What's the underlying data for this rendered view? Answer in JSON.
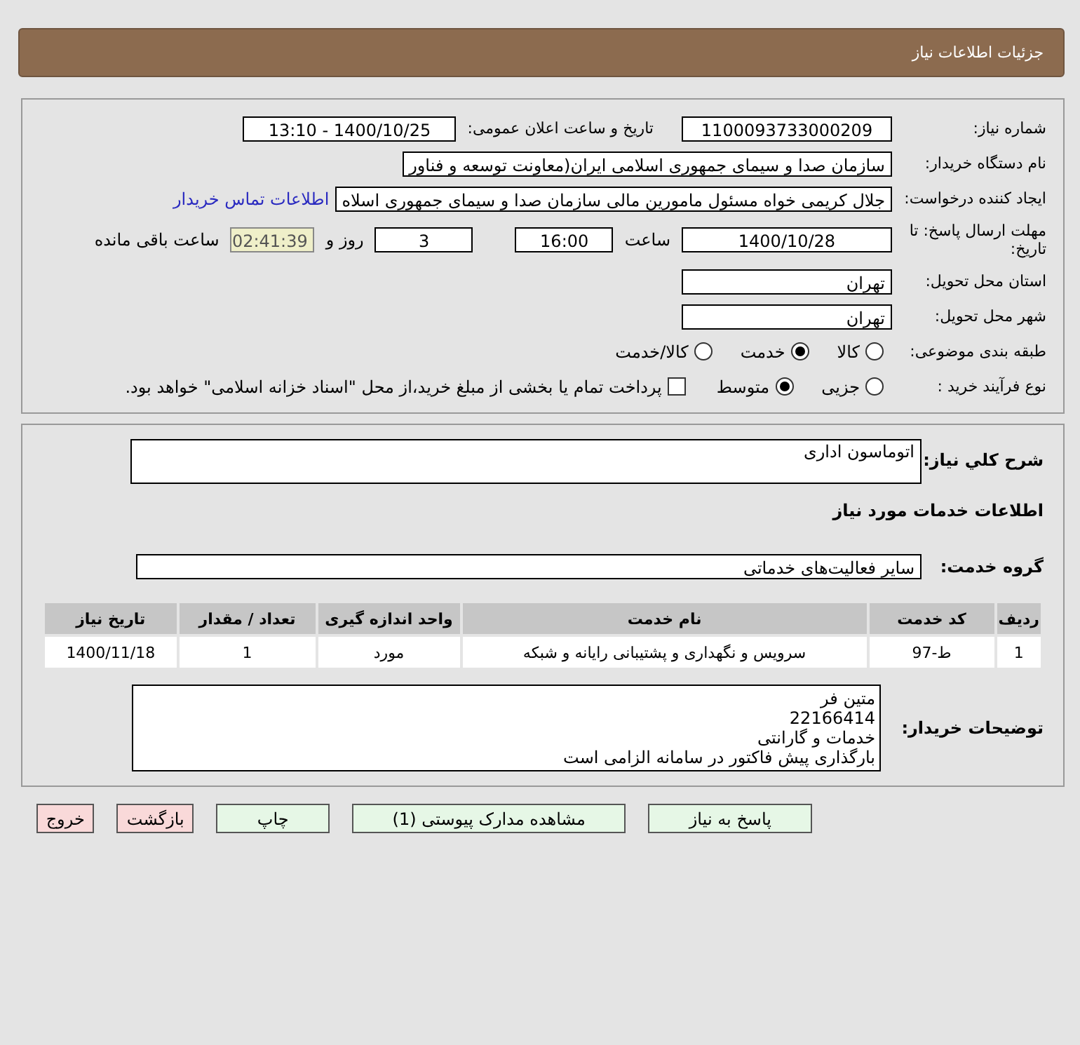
{
  "header": {
    "title": "جزئیات اطلاعات نیاز"
  },
  "details": {
    "need_number": {
      "label": "شماره نیاز:",
      "value": "1100093733000209"
    },
    "announce": {
      "label": "تاریخ و ساعت اعلان عمومی:",
      "value": "1400/10/25 - 13:10"
    },
    "buyer_org": {
      "label": "نام دستگاه خریدار:",
      "value": "سازمان صدا و سیمای جمهوری اسلامی ایران(معاونت توسعه و فناور"
    },
    "requester": {
      "label": "ایجاد کننده درخواست:",
      "value": "جلال کریمی خواه مسئول مامورین مالی  سازمان صدا و سیمای جمهوری اسلاه",
      "link": "اطلاعات تماس خریدار"
    },
    "deadline": {
      "label": "مهلت ارسال پاسخ: تا تاریخ:",
      "date": "1400/10/28",
      "time_label": "ساعت",
      "time": "16:00",
      "days": "3",
      "days_label": "روز و",
      "remaining": "02:41:39",
      "remaining_label": "ساعت باقی مانده"
    },
    "province": {
      "label": "استان محل تحویل:",
      "value": "تهران"
    },
    "city": {
      "label": "شهر محل تحویل:",
      "value": "تهران"
    },
    "category": {
      "label": "طبقه بندی موضوعی:",
      "options": [
        {
          "label": "کالا",
          "selected": false
        },
        {
          "label": "خدمت",
          "selected": true
        },
        {
          "label": "کالا/خدمت",
          "selected": false
        }
      ]
    },
    "process": {
      "label": "نوع فرآیند خرید :",
      "options": [
        {
          "label": "جزیی",
          "selected": false
        },
        {
          "label": "متوسط",
          "selected": true
        }
      ],
      "payment": {
        "label": "پرداخت تمام یا بخشی از مبلغ خرید،از محل \"اسناد خزانه اسلامی\" خواهد بود.",
        "checked": false
      }
    }
  },
  "summary": {
    "label": "شرح کلي نياز:",
    "value": "اتوماسون اداری"
  },
  "services_title": "اطلاعات خدمات مورد نیاز",
  "service_group": {
    "label": "گروه خدمت:",
    "value": "سایر فعالیت‌های خدماتی"
  },
  "table": {
    "columns": [
      "ردیف",
      "کد خدمت",
      "نام خدمت",
      "واحد اندازه گیری",
      "تعداد / مقدار",
      "تاریخ نیاز"
    ],
    "rows": [
      [
        "1",
        "ط-97",
        "سرویس و نگهداری و پشتیبانی رایانه و شبکه",
        "مورد",
        "1",
        "1400/11/18"
      ]
    ]
  },
  "buyer_notes": {
    "label": "توضیحات خریدار:",
    "lines": [
      "متین فر",
      "22166414",
      "خدمات و گارانتی",
      "بارگذاری پیش فاکتور در سامانه الزامی است"
    ]
  },
  "buttons": [
    {
      "label": "پاسخ به نیاز",
      "kind": "green"
    },
    {
      "label": "مشاهده مدارک پیوستی (1)",
      "kind": "green"
    },
    {
      "label": "چاپ",
      "kind": "green"
    },
    {
      "label": "بازگشت",
      "kind": "red"
    },
    {
      "label": "خروج",
      "kind": "red"
    }
  ]
}
